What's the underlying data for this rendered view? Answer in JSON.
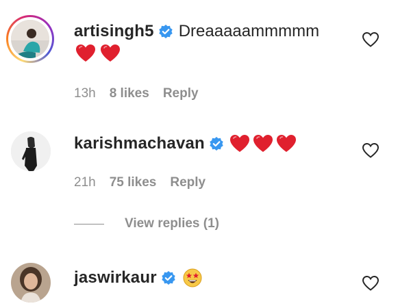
{
  "comments": [
    {
      "username": "artisingh5",
      "verified": true,
      "text": "Dreaaaaammmmm",
      "emoji": [
        "red-heart",
        "red-heart"
      ],
      "time": "13h",
      "likes": "8 likes",
      "reply_label": "Reply"
    },
    {
      "username": "karishmachavan",
      "verified": true,
      "text": "",
      "emoji": [
        "red-heart",
        "red-heart",
        "red-heart"
      ],
      "time": "21h",
      "likes": "75 likes",
      "reply_label": "Reply",
      "view_replies_label": "View replies (1)"
    },
    {
      "username": "jaswirkaur",
      "verified": true,
      "text": "",
      "emoji": [
        "star-struck"
      ]
    }
  ],
  "colors": {
    "text": "#262626",
    "muted": "#8e8e8e",
    "verified_blue": "#3897f0",
    "heart_red": "#e0202e"
  },
  "icons": {
    "like": "heart-outline-icon",
    "verified": "verified-badge-icon"
  }
}
